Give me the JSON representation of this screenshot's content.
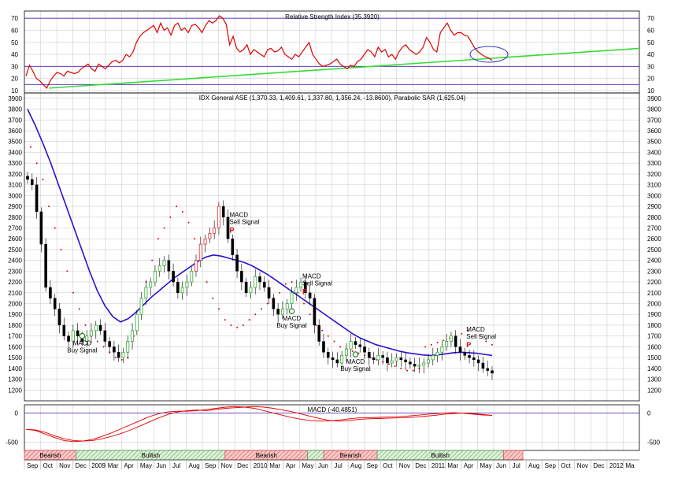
{
  "colors": {
    "rsi_line": "#e00000",
    "trend_line": "#33dd33",
    "band_line": "#4b1fb5",
    "ma_line": "#2a10d0",
    "sar_dot": "#e00000",
    "candle_up": "#33aa33",
    "candle_down": "#000000",
    "candle_red": "#e03030",
    "macd_line": "#e00000",
    "ellipse": "#3333cc",
    "bear": "#e05050",
    "bull": "#55aa55"
  },
  "chart_data": [
    {
      "type": "line",
      "title": "Relative Strength Index (35.3920)",
      "ylim": [
        8,
        76
      ],
      "yticks": [
        10,
        20,
        30,
        40,
        50,
        60,
        70
      ],
      "levels": [
        70,
        30,
        15
      ],
      "trendline": {
        "from": [
          0.04,
          12
        ],
        "to": [
          1.0,
          45
        ]
      },
      "series": [
        {
          "values": [
            22,
            31,
            26,
            20,
            18,
            15,
            12,
            18,
            22,
            25,
            24,
            22,
            26,
            25,
            24,
            25,
            28,
            30,
            32,
            28,
            26,
            32,
            30,
            28,
            31,
            34,
            35,
            33,
            35,
            40,
            38,
            42,
            50,
            55,
            58,
            60,
            62,
            64,
            58,
            66,
            60,
            62,
            56,
            64,
            66,
            60,
            62,
            58,
            64,
            65,
            62,
            58,
            64,
            68,
            66,
            68,
            72,
            70,
            65,
            48,
            55,
            45,
            42,
            44,
            48,
            40,
            44,
            42,
            40,
            38,
            44,
            45,
            42,
            43,
            46,
            40,
            38,
            36,
            40,
            38,
            42,
            46,
            50,
            40,
            36,
            32,
            30,
            31,
            32,
            34,
            36,
            32,
            30,
            28,
            31,
            30,
            34,
            36,
            40,
            44,
            42,
            38,
            46,
            42,
            44,
            38,
            40,
            36,
            42,
            46,
            48,
            44,
            42,
            40,
            42,
            46,
            54,
            50,
            44,
            42,
            58,
            62,
            66,
            60,
            56,
            58,
            58,
            56,
            55,
            50,
            45,
            42,
            40,
            38,
            37,
            35
          ]
        }
      ]
    },
    {
      "type": "candlestick",
      "title": "IDX General ASE (1,370.33, 1,409.61, 1,337.80, 1,356.24, -13.8600), Parabolic SAR (1,625.04)",
      "ylim": [
        1100,
        3950
      ],
      "yticks": [
        1200,
        1300,
        1400,
        1500,
        1600,
        1700,
        1800,
        1900,
        2000,
        2100,
        2200,
        2300,
        2400,
        2500,
        2600,
        2700,
        2800,
        2900,
        3000,
        3100,
        3200,
        3300,
        3400,
        3500,
        3600,
        3700,
        3800,
        3900
      ],
      "close": [
        3150,
        3100,
        2850,
        2550,
        2150,
        2050,
        1950,
        1800,
        1700,
        1650,
        1750,
        1700,
        1650,
        1700,
        1750,
        1800,
        1750,
        1650,
        1600,
        1550,
        1500,
        1550,
        1650,
        1750,
        1900,
        2050,
        2150,
        2200,
        2300,
        2350,
        2400,
        2300,
        2200,
        2100,
        2150,
        2200,
        2300,
        2400,
        2550,
        2600,
        2650,
        2700,
        2900,
        2800,
        2600,
        2450,
        2300,
        2200,
        2100,
        2150,
        2250,
        2200,
        2150,
        2050,
        1950,
        1900,
        1950,
        2000,
        2100,
        2150,
        2200,
        2100,
        2050,
        1800,
        1650,
        1550,
        1500,
        1480,
        1450,
        1520,
        1580,
        1650,
        1620,
        1600,
        1550,
        1500,
        1480,
        1520,
        1500,
        1450,
        1470,
        1500,
        1480,
        1460,
        1440,
        1420,
        1430,
        1450,
        1480,
        1520,
        1550,
        1600,
        1650,
        1700,
        1600,
        1550,
        1520,
        1500,
        1480,
        1450,
        1400,
        1380,
        1356
      ],
      "ma": [
        3800,
        3650,
        3480,
        3300,
        3100,
        2900,
        2700,
        2500,
        2300,
        2120,
        1980,
        1880,
        1830,
        1860,
        1920,
        1990,
        2060,
        2120,
        2180,
        2240,
        2290,
        2340,
        2390,
        2430,
        2450,
        2440,
        2420,
        2400,
        2380,
        2350,
        2310,
        2270,
        2220,
        2170,
        2120,
        2070,
        2020,
        1970,
        1920,
        1870,
        1820,
        1770,
        1720,
        1680,
        1650,
        1620,
        1600,
        1580,
        1560,
        1545,
        1535,
        1525,
        1520,
        1525,
        1535,
        1545,
        1550,
        1545,
        1540,
        1530,
        1520
      ],
      "sar": [
        3450,
        3300,
        3150,
        2900,
        2700,
        2500,
        2300,
        2100,
        1950,
        1800,
        1700,
        1650,
        1600,
        1550,
        1500,
        1480,
        1500,
        1700,
        1950,
        2200,
        2400,
        2600,
        2700,
        2800,
        2900,
        2850,
        2750,
        2600,
        2400,
        2200,
        2050,
        1950,
        1850,
        1800,
        1780,
        1800,
        1850,
        1900,
        1950,
        2000,
        2050,
        2100,
        2180,
        2200,
        2100,
        2000,
        1900,
        1800,
        1750,
        1700,
        1650,
        1600,
        1580,
        1560,
        1540,
        1520,
        1500,
        1480,
        1460,
        1440,
        1420,
        1400,
        1380,
        1380,
        1400,
        1600,
        1620,
        1640,
        1660,
        1680,
        1700,
        1720,
        1750,
        1780,
        1700,
        1650,
        1620
      ]
    },
    {
      "type": "line",
      "title": "MACD (-40.4851)",
      "ylim": [
        -640,
        140
      ],
      "yticks": [
        0,
        -500
      ],
      "series": [
        {
          "values": [
            -280,
            -290,
            -330,
            -390,
            -440,
            -470,
            -480,
            -470,
            -440,
            -400,
            -350,
            -290,
            -220,
            -150,
            -80,
            -20,
            20,
            40,
            50,
            40,
            60,
            80,
            90,
            100,
            110,
            100,
            80,
            50,
            20,
            -20,
            -60,
            -100,
            -130,
            -140,
            -130,
            -110,
            -100,
            -95,
            -90,
            -85,
            -80,
            -70,
            -55,
            -40,
            -20,
            -10,
            0,
            -10,
            -25,
            -40
          ]
        },
        {
          "values": [
            -280,
            -300,
            -360,
            -420,
            -470,
            -490,
            -480,
            -450,
            -400,
            -340,
            -270,
            -200,
            -130,
            -60,
            -10,
            20,
            30,
            30,
            40,
            60,
            80,
            100,
            110,
            100,
            80,
            40,
            0,
            -40,
            -80,
            -110,
            -130,
            -140,
            -135,
            -120,
            -100,
            -85,
            -80,
            -75,
            -70,
            -65,
            -55,
            -40,
            -25,
            -10,
            0,
            5,
            -5,
            -20,
            -35,
            -40
          ]
        }
      ]
    }
  ],
  "signals": [
    {
      "id": "macd-buy-1",
      "line1": "MACD",
      "line2": "Buy Signal"
    },
    {
      "id": "macd-sell-1",
      "line1": "MACD",
      "line2": "Sell Signal"
    },
    {
      "id": "macd-sell-2",
      "line1": "MACD",
      "line2": "Sell Signal"
    },
    {
      "id": "macd-buy-2",
      "line1": "MACD",
      "line2": "Buy Signal"
    },
    {
      "id": "macd-buy-3",
      "line1": "MACD",
      "line2": "Buy Signal"
    },
    {
      "id": "macd-sell-3",
      "line1": "MACD",
      "line2": "Sell Signal"
    }
  ],
  "sar_flip_marker": "P",
  "phases": [
    {
      "label": "Bearish",
      "kind": "bear"
    },
    {
      "label": "Bullish",
      "kind": "bull"
    },
    {
      "label": "Bearish",
      "kind": "bear"
    },
    {
      "label": "",
      "kind": "bull"
    },
    {
      "label": "Bearish",
      "kind": "bear"
    },
    {
      "label": "Bullish",
      "kind": "bull"
    },
    {
      "label": "",
      "kind": "bear"
    }
  ],
  "x_axis_labels": [
    "Sep",
    "Oct",
    "Nov",
    "Dec",
    "2009",
    "Mar",
    "Apr",
    "May",
    "Jun",
    "Jul",
    "Aug",
    "Sep",
    "Nov",
    "Dec",
    "2010",
    "Mar",
    "Apr",
    "May",
    "Jun",
    "Jul",
    "Aug",
    "Sep",
    "Oct",
    "Nov",
    "Dec",
    "2011",
    "Mar",
    "Apr",
    "May",
    "Jun",
    "Jul",
    "Aug",
    "Sep",
    "Oct",
    "Nov",
    "Dec",
    "2012",
    "Ma"
  ]
}
